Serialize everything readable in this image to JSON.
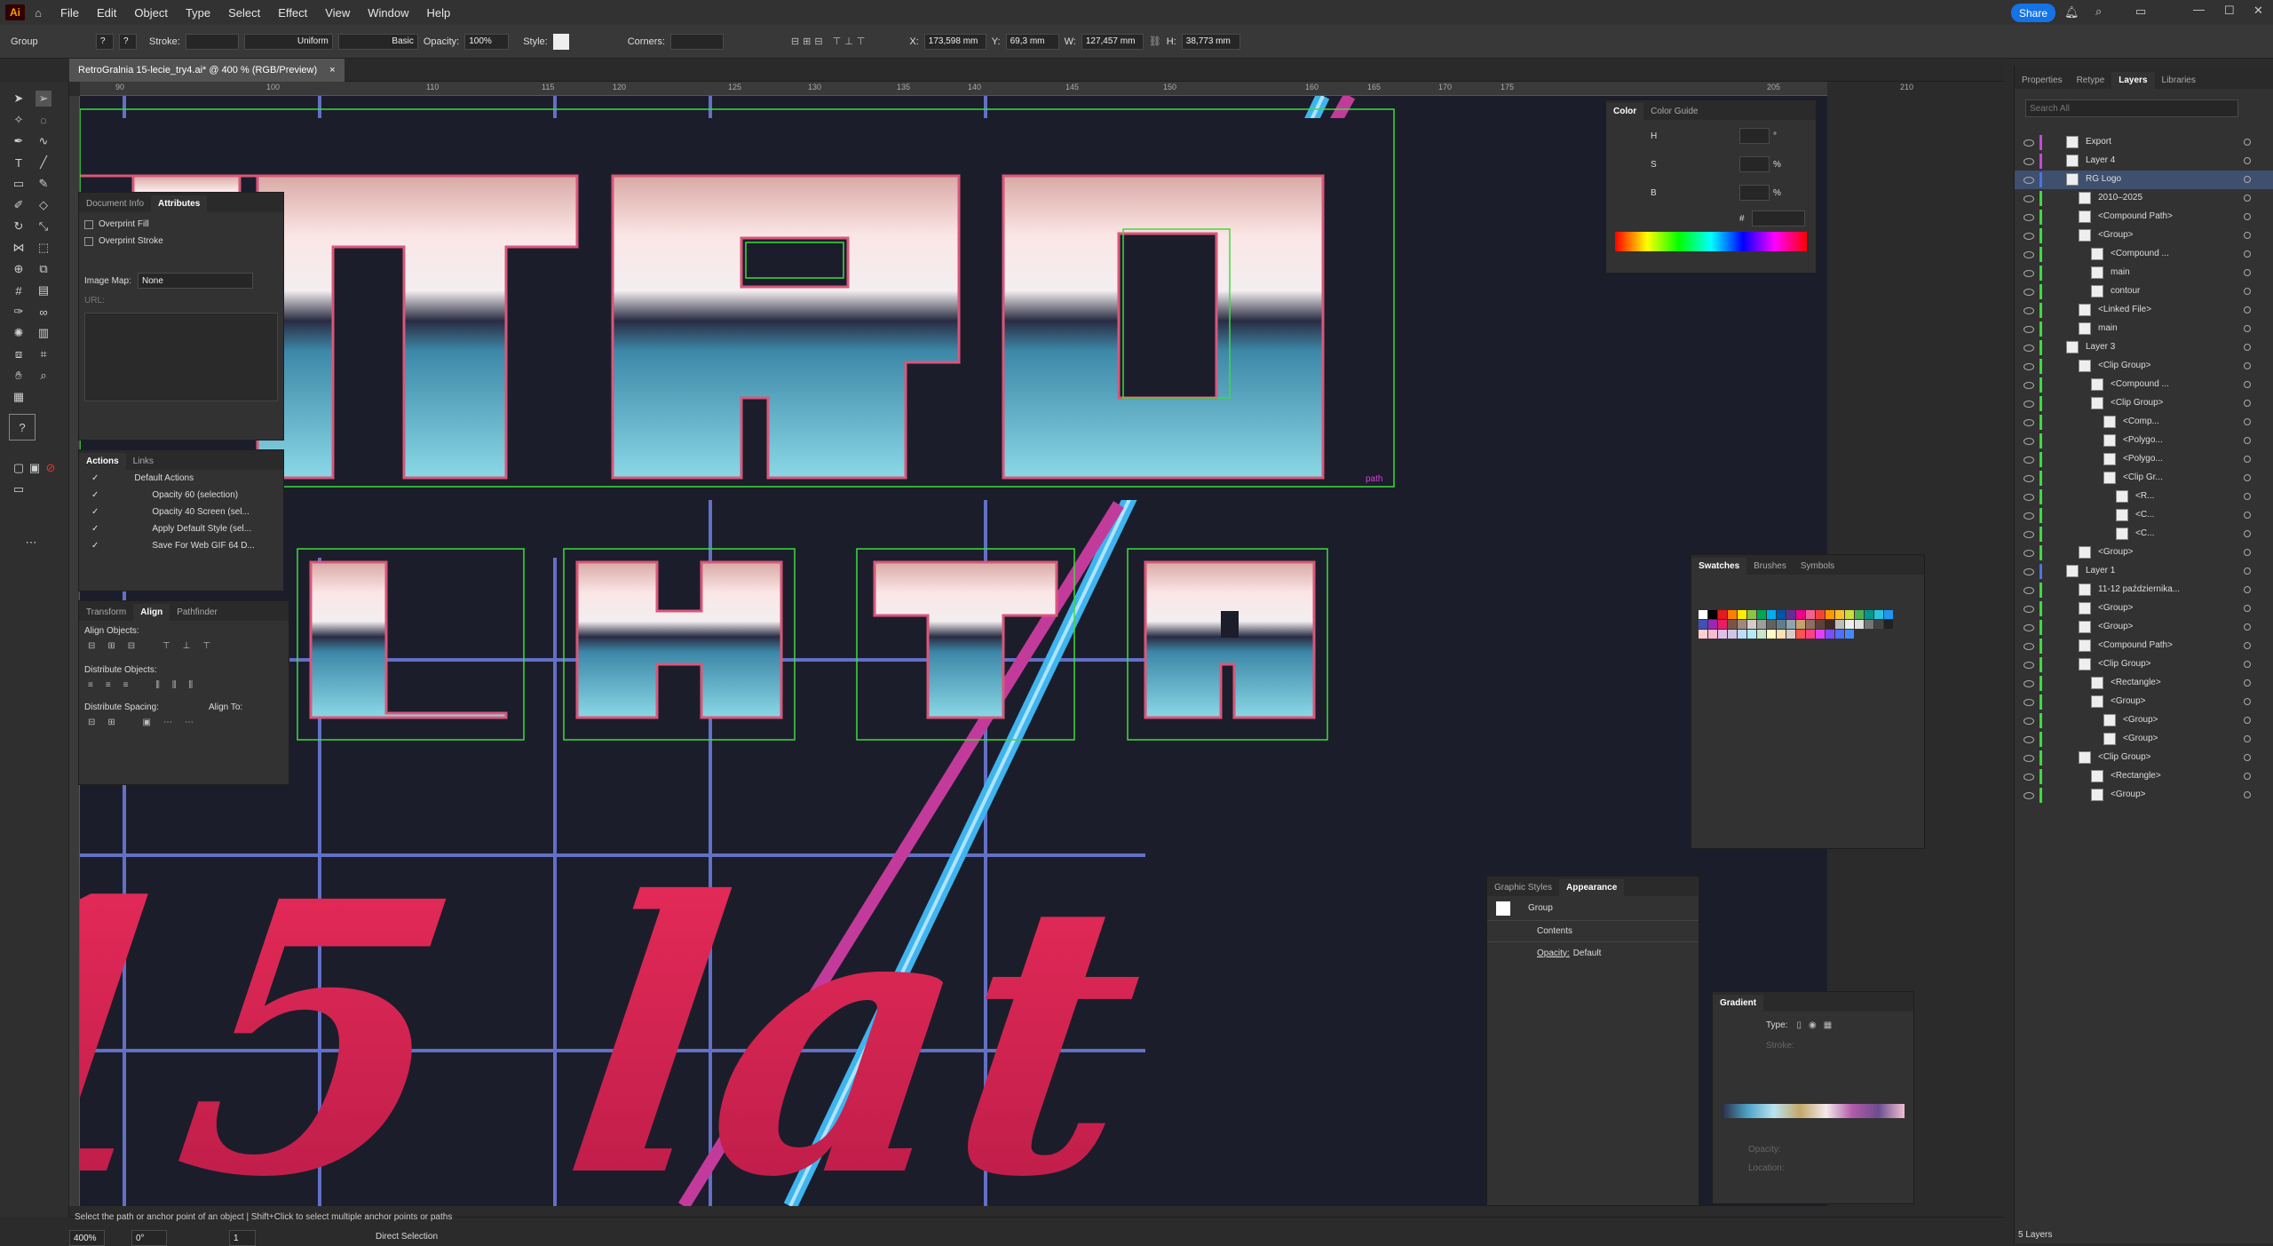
{
  "app": {
    "logo": "Ai"
  },
  "menu": [
    "File",
    "Edit",
    "Object",
    "Type",
    "Select",
    "Effect",
    "View",
    "Window",
    "Help"
  ],
  "share_label": "Share",
  "control_bar": {
    "selection_type": "Group",
    "stroke_label": "Stroke:",
    "stroke_profile": "Uniform",
    "brush": "Basic",
    "opacity_label": "Opacity:",
    "opacity_value": "100%",
    "style_label": "Style:",
    "corners_label": "Corners:",
    "x_label": "X:",
    "x_value": "173,598 mm",
    "y_label": "Y:",
    "y_value": "69,3 mm",
    "w_label": "W:",
    "w_value": "127,457 mm",
    "h_label": "H:",
    "h_value": "38,773 mm"
  },
  "document_tab": {
    "title": "RetroGralnia 15-lecie_try4.ai* @ 400 % (RGB/Preview)",
    "close": "×"
  },
  "ruler_ticks": [
    "90",
    "100",
    "110",
    "115",
    "120",
    "125",
    "130",
    "135",
    "140",
    "145",
    "150",
    "160",
    "165",
    "170",
    "175",
    "205",
    "210"
  ],
  "canvas_label": "path",
  "attributes_panel": {
    "tabs": [
      "Document Info",
      "Attributes"
    ],
    "overprint_fill": "Overprint Fill",
    "overprint_stroke": "Overprint Stroke",
    "image_map_label": "Image Map:",
    "image_map_value": "None",
    "url_label": "URL:"
  },
  "actions_panel": {
    "tabs": [
      "Actions",
      "Links"
    ],
    "items": [
      "Default Actions",
      "Opacity 60 (selection)",
      "Opacity 40 Screen (sel...",
      "Apply Default Style (sel...",
      "Save For Web GIF 64 D..."
    ]
  },
  "align_panel": {
    "tabs": [
      "Transform",
      "Align",
      "Pathfinder"
    ],
    "align_objects": "Align Objects:",
    "distribute_objects": "Distribute Objects:",
    "distribute_spacing": "Distribute Spacing:",
    "align_to": "Align To:"
  },
  "color_panel": {
    "tabs": [
      "Color",
      "Color Guide"
    ],
    "channels": [
      "H",
      "S",
      "B"
    ],
    "units": [
      "°",
      "%",
      "%"
    ],
    "hex_label": "#"
  },
  "swatches_panel": {
    "tabs": [
      "Swatches",
      "Brushes",
      "Symbols"
    ]
  },
  "appearance_panel": {
    "tabs": [
      "Graphic Styles",
      "Appearance"
    ],
    "object": "Group",
    "contents": "Contents",
    "opacity": "Opacity:",
    "opacity_value": "Default"
  },
  "gradient_panel": {
    "title": "Gradient",
    "type_label": "Type:",
    "stroke_label": "Stroke:",
    "opacity_label": "Opacity:",
    "location_label": "Location:"
  },
  "layers_panel": {
    "tabs": [
      "Properties",
      "Retype",
      "Layers",
      "Libraries"
    ],
    "search_placeholder": "Search All",
    "rows": [
      "Export",
      "Layer 4",
      "RG Logo",
      "2010–2025",
      "<Compound Path>",
      "<Group>",
      "<Compound ...",
      "main",
      "contour",
      "<Linked File>",
      "main",
      "Layer 3",
      "<Clip Group>",
      "<Compound ...",
      "<Clip Group>",
      "<Comp...",
      "<Polygo...",
      "<Polygo...",
      "<Clip Gr...",
      "<R...",
      "<C...",
      "<C...",
      "<Group>",
      "Layer 1",
      "11-12  października...",
      "<Group>",
      "<Group>",
      "<Compound Path>",
      "<Clip Group>",
      "<Rectangle>",
      "<Group>",
      "<Group>",
      "<Group>",
      "<Clip Group>",
      "<Rectangle>",
      "<Group>"
    ],
    "footer": "5 Layers"
  },
  "status": {
    "hint": "Select the path or anchor point of an object  |  Shift+Click to select multiple anchor points or paths",
    "zoom": "400%",
    "rotation": "0°",
    "artboard": "1",
    "tool": "Direct Selection"
  },
  "artwork": {
    "letters_top": [
      "T",
      "R",
      "O"
    ],
    "letters_bottom": [
      "L",
      "N",
      "I",
      "A"
    ],
    "script": "15 lat"
  },
  "colors": {
    "accent": "#1473e6",
    "canvas_bg": "#1c1d2b",
    "neon_pink": "#e62e63",
    "neon_blue": "#3fb4ee",
    "selection_green": "#3ddc3d"
  }
}
